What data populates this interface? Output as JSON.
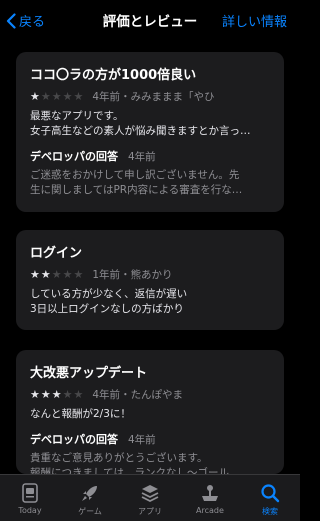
{
  "nav": {
    "back_label": "戻る",
    "title": "評価とレビュー",
    "right_label": "詳しい情報"
  },
  "reviews": [
    {
      "title": "ココ〇ラの方が1000倍良い",
      "rating": 1,
      "date": "4年前",
      "author": "みみままま「やひ",
      "body_lines": [
        "最悪なアプリです。",
        "女子高生などの素人が悩み聞きますとか言っ…"
      ],
      "dev_label": "デベロッパの回答",
      "dev_date": "4年前",
      "dev_lines": [
        "ご迷惑をおかけして申し訳ございません。先",
        "生に関しましてはPR内容による審査を行な…"
      ]
    },
    {
      "title": "ログイン",
      "rating": 2,
      "date": "1年前",
      "author": "熊あかり",
      "body_lines": [
        "している方が少なく、返信が遅い",
        "3日以上ログインなしの方ばかり"
      ]
    },
    {
      "title": "大改悪アップデート",
      "rating": 3,
      "date": "4年前",
      "author": "たんぽやま",
      "body_lines": [
        "なんと報酬が2/3に！"
      ],
      "dev_label": "デベロッパの回答",
      "dev_date": "4年前",
      "dev_lines": [
        "貴重なご意見ありがとうございます。",
        "報酬につきましては、ランクなし〜ゴール…"
      ]
    }
  ],
  "separator": "・",
  "tabs": [
    {
      "label": "Today",
      "icon": "today-icon",
      "active": false
    },
    {
      "label": "ゲーム",
      "icon": "rocket-icon",
      "active": false
    },
    {
      "label": "アプリ",
      "icon": "apps-stack-icon",
      "active": false
    },
    {
      "label": "Arcade",
      "icon": "arcade-joystick-icon",
      "active": false
    },
    {
      "label": "検索",
      "icon": "search-icon",
      "active": true
    }
  ],
  "colors": {
    "accent": "#0a84ff",
    "card": "#1c1c1e",
    "star_on": "#e5e5ea",
    "star_off": "#48484a"
  }
}
